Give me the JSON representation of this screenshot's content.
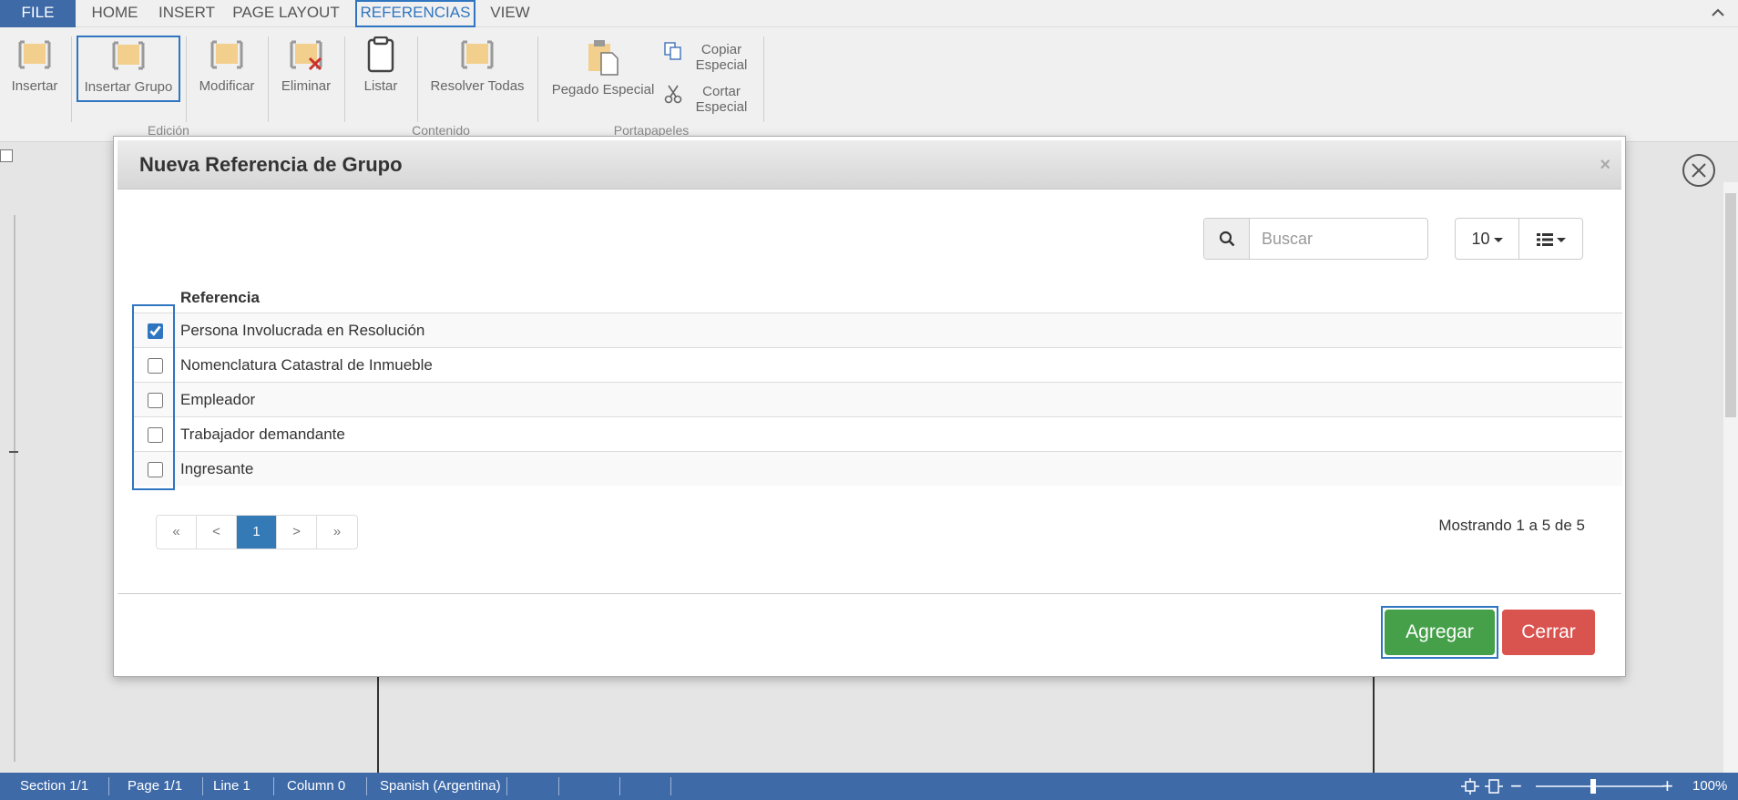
{
  "ribbon_tabs": [
    "FILE",
    "HOME",
    "INSERT",
    "PAGE LAYOUT",
    "REFERENCIAS",
    "VIEW"
  ],
  "ribbon": {
    "insertar": "Insertar",
    "insertar_grupo": "Insertar Grupo",
    "modificar": "Modificar",
    "eliminar": "Eliminar",
    "listar": "Listar",
    "resolver_todas": "Resolver Todas",
    "pegado_especial": "Pegado Especial",
    "copiar_especial_1": "Copiar",
    "copiar_especial_2": "Especial",
    "cortar_especial_1": "Cortar",
    "cortar_especial_2": "Especial",
    "group_edicion": "Edición",
    "group_contenido": "Contenido",
    "group_portapapeles": "Portapapeles"
  },
  "modal": {
    "title": "Nueva Referencia de Grupo",
    "close_glyph": "×",
    "search_placeholder": "Buscar",
    "page_size": "10",
    "column_header": "Referencia",
    "rows": [
      {
        "label": "Persona Involucrada en Resolución",
        "checked": true
      },
      {
        "label": "Nomenclatura Catastral de Inmueble",
        "checked": false
      },
      {
        "label": "Empleador",
        "checked": false
      },
      {
        "label": "Trabajador demandante",
        "checked": false
      },
      {
        "label": "Ingresante",
        "checked": false
      }
    ],
    "pagination": [
      "«",
      "<",
      "1",
      ">",
      "»"
    ],
    "showing": "Mostrando 1 a 5 de 5",
    "add_button": "Agregar",
    "close_button": "Cerrar"
  },
  "statusbar": {
    "section": "Section 1/1",
    "page": "Page 1/1",
    "line": "Line 1",
    "column": "Column 0",
    "language": "Spanish (Argentina)",
    "zoom": "100%"
  },
  "colors": {
    "accent": "#2f75c0",
    "file_tab": "#3e6aa8",
    "add_button": "#45a049",
    "close_button": "#d9534f"
  }
}
